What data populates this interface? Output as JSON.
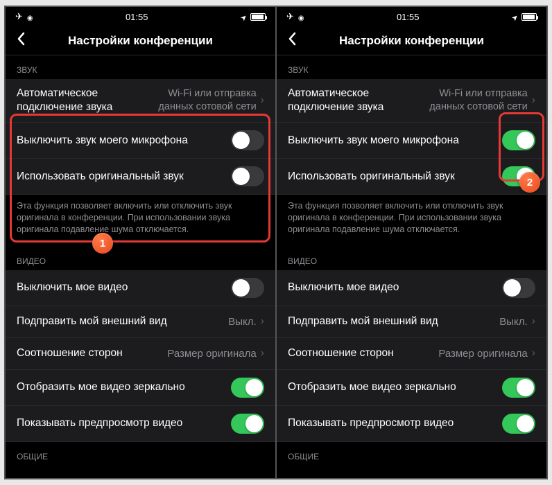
{
  "status": {
    "time": "01:55"
  },
  "header": {
    "title": "Настройки конференции"
  },
  "sections": {
    "sound": {
      "header": "ЗВУК",
      "auto_connect": {
        "label": "Автоматическое подключение звука",
        "value": "Wi-Fi или отправка данных сотовой сети"
      },
      "mute_mic": "Выключить звук моего микрофона",
      "original_sound": "Использовать оригинальный звук",
      "footer": "Эта функция позволяет включить или отключить звук оригинала в конференции. При использовании звука оригинала подавление шума отключается."
    },
    "video": {
      "header": "ВИДЕО",
      "turn_off": "Выключить мое видео",
      "touch_up": {
        "label": "Подправить мой внешний вид",
        "value": "Выкл."
      },
      "aspect": {
        "label": "Соотношение сторон",
        "value": "Размер оригинала"
      },
      "mirror": "Отобразить мое видео зеркально",
      "preview": "Показывать предпросмотр видео"
    },
    "general": {
      "header": "ОБЩИЕ"
    }
  },
  "badges": {
    "one": "1",
    "two": "2"
  }
}
